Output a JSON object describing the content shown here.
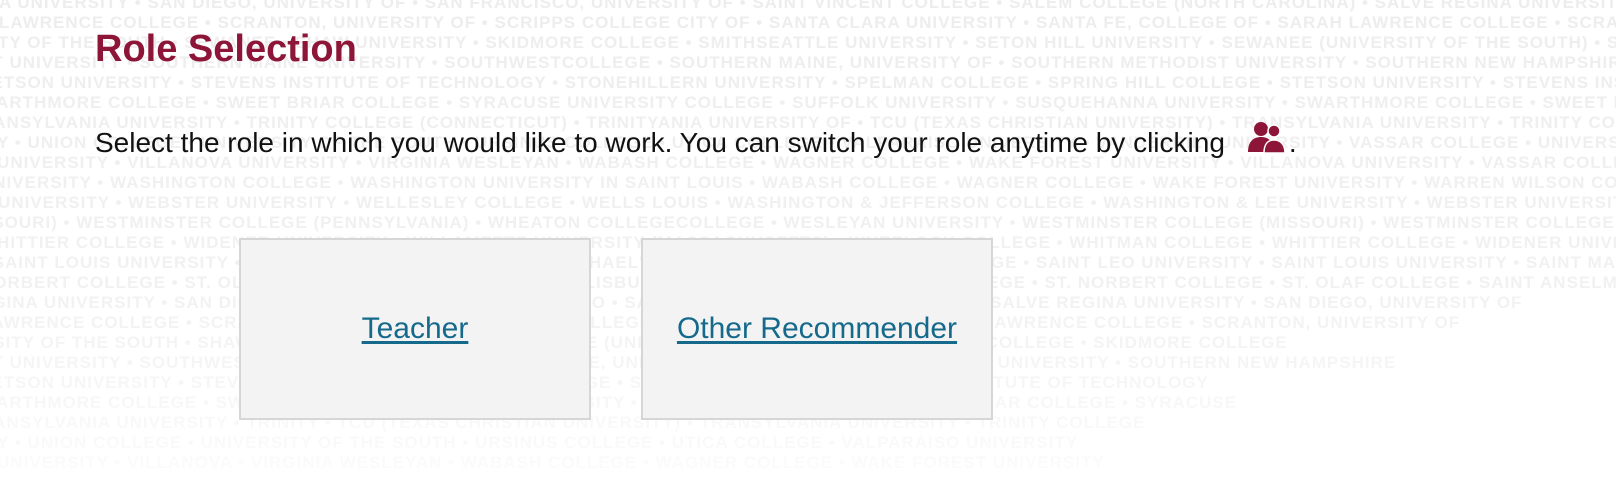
{
  "page": {
    "title": "Role Selection",
    "instructions": "Select the role in which you would like to work. You can switch your role anytime by clicking",
    "instructions_end": "."
  },
  "roles": [
    {
      "label": "Teacher"
    },
    {
      "label": "Other Recommender"
    }
  ],
  "background_text": [
    "INA UNIVERSITY • SAN DIEGO, UNIVERSITY OF • SAN FRANCISCO, UNIVERSITY OF • SAINT VINCENT COLLEGE • SALEM COLLEGE (NORTH CAROLINA) • SALVE REGINA UNIVERSITY • SAN DIEGO, UNIVERSITY",
    "H LAWRENCE COLLEGE • SCRANTON, UNIVERSITY OF • SCRIPPS COLLEGE CITY OF • SANTA CLARA UNIVERSITY • SANTA FE, COLLEGE OF • SARAH LAWRENCE COLLEGE • SCRANTON, UNIVERSI",
    "SITY OF THE SOUTH • SEWANEE • SHAW UNIVERSITY • SKIDMORE COLLEGE • SMITHSEATTLE UNIVERSITY • SETON HILL UNIVERSITY • SEWANEE (UNIVERSITY OF THE SOUTH) • SIMMONS COLLEGE",
    "ST UNIVERSITY • SOUTHERN MAINE UNIVERSITY • SOUTHWESTCOLLEGE • SOUTHERN MAINE, UNIVERSITY OF • SOUTHERN METHODIST UNIVERSITY • SOUTHERN NEW HAMPSHIRE",
    "TETSON UNIVERSITY • STEVENS INSTITUTE OF TECHNOLOGY • STONEHILLERN UNIVERSITY • SPELMAN COLLEGE • SPRING HILL COLLEGE • STETSON UNIVERSITY • STEVENS INSTITUTE",
    "WARTHMORE COLLEGE • SWEET BRIAR COLLEGE • SYRACUSE UNIVERSITY COLLEGE • SUFFOLK UNIVERSITY • SUSQUEHANNA UNIVERSITY • SWARTHMORE COLLEGE • SWEET BRIAR COLLEGE",
    "RANSYLVANIA UNIVERSITY • TRINITY COLLEGE (CONNECTICUT) • TRINITYANIA UNIVERSITY OF • TCU (TEXAS CHRISTIAN UNIVERSITY) • TRANSYLVANIA UNIVERSITY • TRINITY COLLEGE",
    "ITY • UNION COLLEGE • UNIVERSITY OF THE SOUTH • URSINUS COLLEGE • UTICA COLLEGE • VALPARAISO UNIVERSITY • VANDERBILT UNIVERSITY • VASSAR COLLEGE • UNIVERSITY OF • UNION",
    "T UNIVERSITY • VILLANOVA UNIVERSITY • VIRGINIA WESLEYAN • WABASH COLLEGE • WAGNER COLLEGE • WAKE FOREST UNIVERSITY • VILLANOVA UNIVERSITY • VASSAR COLLEGE • VERMONT",
    "UNIVERSITY • WASHINGTON COLLEGE • WASHINGTON UNIVERSITY IN SAINT LOUIS • WABASH COLLEGE • WAGNER COLLEGE • WAKE FOREST UNIVERSITY • WARREN WILSON COLLEGE • WASHINGTON",
    "E UNIVERSITY • WEBSTER UNIVERSITY • WELLESLEY COLLEGE • WELLS LOUIS • WASHINGTON & JEFFERSON COLLEGE • WASHINGTON & LEE UNIVERSITY • WEBSTER UNIVERSITY • WELLESLEY",
    "SSOURI) • WESTMINSTER COLLEGE (PENNSYLVANIA) • WHEATON COLLEGECOLLEGE • WESLEYAN UNIVERSITY • WESTMINSTER COLLEGE (MISSOURI) • WESTMINSTER COLLEGE (PENNSYLVANIA)",
    "WHITTIER COLLEGE • WIDENER UNIVERSITY • WILLAMETTE UNIVERSITY (MASSACHUSETTS) • WHEELOCK COLLEGE • WHITMAN COLLEGE • WHITTIER COLLEGE • WIDENER UNIVERSITY",
    "• SAINT LOUIS UNIVERSITY • SAINT MARY'S COLLEGE • SAINT MICHAEL'S COLLEGE • SAINT NORBERT COLLEGE • SAINT LEO UNIVERSITY • SAINT LOUIS UNIVERSITY • SAINT MARY'S",
    "NORBERT COLLEGE • ST. OLAF COLLEGE • SALEM COLLEGE • SALISBURY UNIVERSITY • ST. MICHAELS COLLEGE • ST. NORBERT COLLEGE • ST. OLAF COLLEGE • SAINT ANSELM",
    "EGINA UNIVERSITY • SAN DIEGO, UNIVERSITY OF • SAN FRANCISCO • SALEM COLLEGE (NORTH CAROLINA) • SALVE REGINA UNIVERSITY • SAN DIEGO, UNIVERSITY OF",
    "LAWRENCE COLLEGE • SCRANTON, UNIVERSITY OF • SCRIPPS COLLEGE • SANTA FE, COLLEGE OF • SARAH LAWRENCE COLLEGE • SCRANTON, UNIVERSITY OF",
    "RSITY OF THE SOUTH • SHAW UNIVERSITY • SKIDMORE • SEWANEE (UNIVERSITY OF THE SOUTH) • SIMMONS COLLEGE • SKIDMORE COLLEGE",
    "ST UNIVERSITY • SOUTHWESTERN UNIVERSITY • SOUTHERN MAINE, UNIVERSITY OF • SOUTHERN METHODIST UNIVERSITY • SOUTHERN NEW HAMPSHIRE",
    "TETSON UNIVERSITY • STEVENS INSTITUTE • SPRING HILL COLLEGE • STETSON UNIVERSITY • STEVENS INSTITUTE OF TECHNOLOGY",
    "WARTHMORE COLLEGE • SWEET BRIAR • SUSQUEHANNA UNIVERSITY • SWARTHMORE COLLEGE • SWEET BRIAR COLLEGE • SYRACUSE",
    "RANSYLVANIA UNIVERSITY • TRINITY • TCU (TEXAS CHRISTIAN UNIVERSITY) • TRANSYLVANIA UNIVERSITY • TRINITY COLLEGE",
    "ITY • UNION COLLEGE • UNIVERSITY OF THE SOUTH • URSINUS COLLEGE • UTICA COLLEGE • VALPARAISO UNIVERSITY",
    "T UNIVERSITY • VILLANOVA • VIRGINIA WESLEYAN • WABASH COLLEGE • WAGNER COLLEGE • WAKE FOREST UNIVERSITY"
  ],
  "icons": {
    "switch_role": "switch-role-icon"
  },
  "colors": {
    "title": "#8c1538",
    "link": "#156a8c",
    "card_bg": "#f3f3f3",
    "card_border": "#d6d6d6",
    "icon": "#8c1538"
  }
}
